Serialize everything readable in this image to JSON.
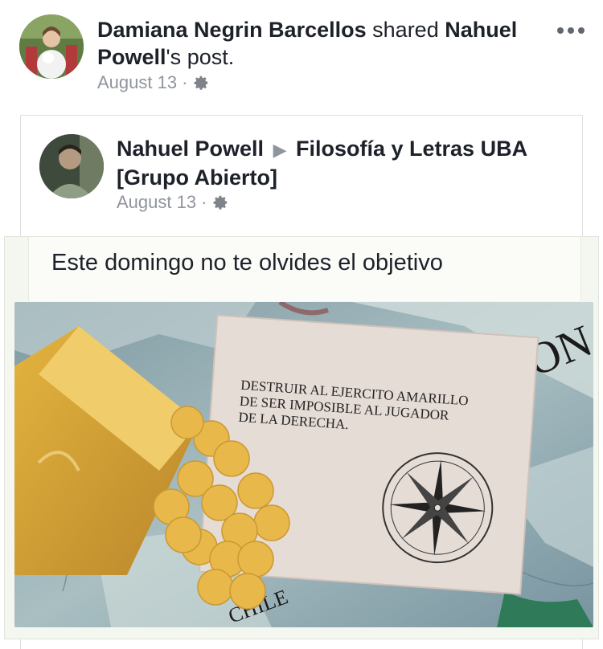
{
  "sharer": {
    "name": "Damiana Negrin Barcellos",
    "action_text": "shared",
    "original_author": "Nahuel Powell",
    "suffix": "'s post.",
    "date": "August 13",
    "dot": "·",
    "privacy_icon": "gear-icon",
    "more_icon": "more-options-icon"
  },
  "shared_post": {
    "author": "Nahuel Powell",
    "separator_icon": "right-triangle-icon",
    "group": "Filosofía y Letras UBA [Grupo Abierto]",
    "date": "August 13",
    "dot": "·",
    "privacy_icon": "gear-icon",
    "text": "Este domingo no te olvides el objetivo"
  },
  "photo": {
    "card_text_line1": "DESTRUIR AL EJERCITO AMARILLO",
    "card_text_line2": "DE SER IMPOSIBLE AL JUGADOR",
    "card_text_line3": "DE LA DERECHA.",
    "map_text_top": "ION",
    "map_text_bottom": "CHILE"
  },
  "colors": {
    "text": "#1d2129",
    "meta": "#90949c",
    "border": "#dddfe2",
    "chip": "#e8b84a"
  }
}
